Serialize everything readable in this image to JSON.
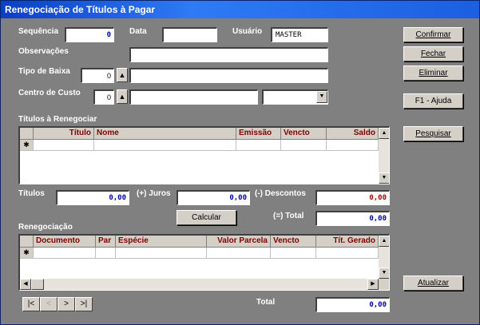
{
  "window": {
    "title": "Renegociação de Títulos à Pagar"
  },
  "form": {
    "sequencia_label": "Sequência",
    "sequencia_value": "0",
    "data_label": "Data",
    "data_value": "",
    "usuario_label": "Usuário",
    "usuario_value": "MASTER",
    "observacoes_label": "Observações",
    "tipo_baixa_label": "Tipo de Baixa",
    "tipo_baixa_value": "0",
    "centro_custo_label": "Centro de Custo",
    "centro_custo_value": "0"
  },
  "buttons": {
    "confirmar": "Confirmar",
    "fechar": "Fechar",
    "eliminar": "Eliminar",
    "ajuda": "F1 - Ajuda",
    "pesquisar": "Pesquisar",
    "atualizar": "Atualizar",
    "calcular": "Calcular"
  },
  "titulos_grid": {
    "caption": "Títulos à Renegociar",
    "columns": [
      "Título",
      "Nome",
      "Emissão",
      "Vencto",
      "Saldo"
    ],
    "new_row_marker": "✱"
  },
  "totals": {
    "titulos_label": "Títulos",
    "titulos_value": "0,00",
    "juros_label": "(+) Juros",
    "juros_value": "0,00",
    "descontos_label": "(-) Descontos",
    "descontos_value": "0,00",
    "total_label": "(=) Total",
    "total_value": "0,00"
  },
  "renegociacao_grid": {
    "caption": "Renegociação",
    "columns": [
      "Documento",
      "Par",
      "Espécie",
      "Valor Parcela",
      "Vencto",
      "Tít. Gerado"
    ],
    "new_row_marker": "✱"
  },
  "footer": {
    "total_label": "Total",
    "total_value": "0,00"
  },
  "navigator": {
    "first": "|<",
    "prev": "<",
    "next": ">",
    "last": ">|"
  }
}
